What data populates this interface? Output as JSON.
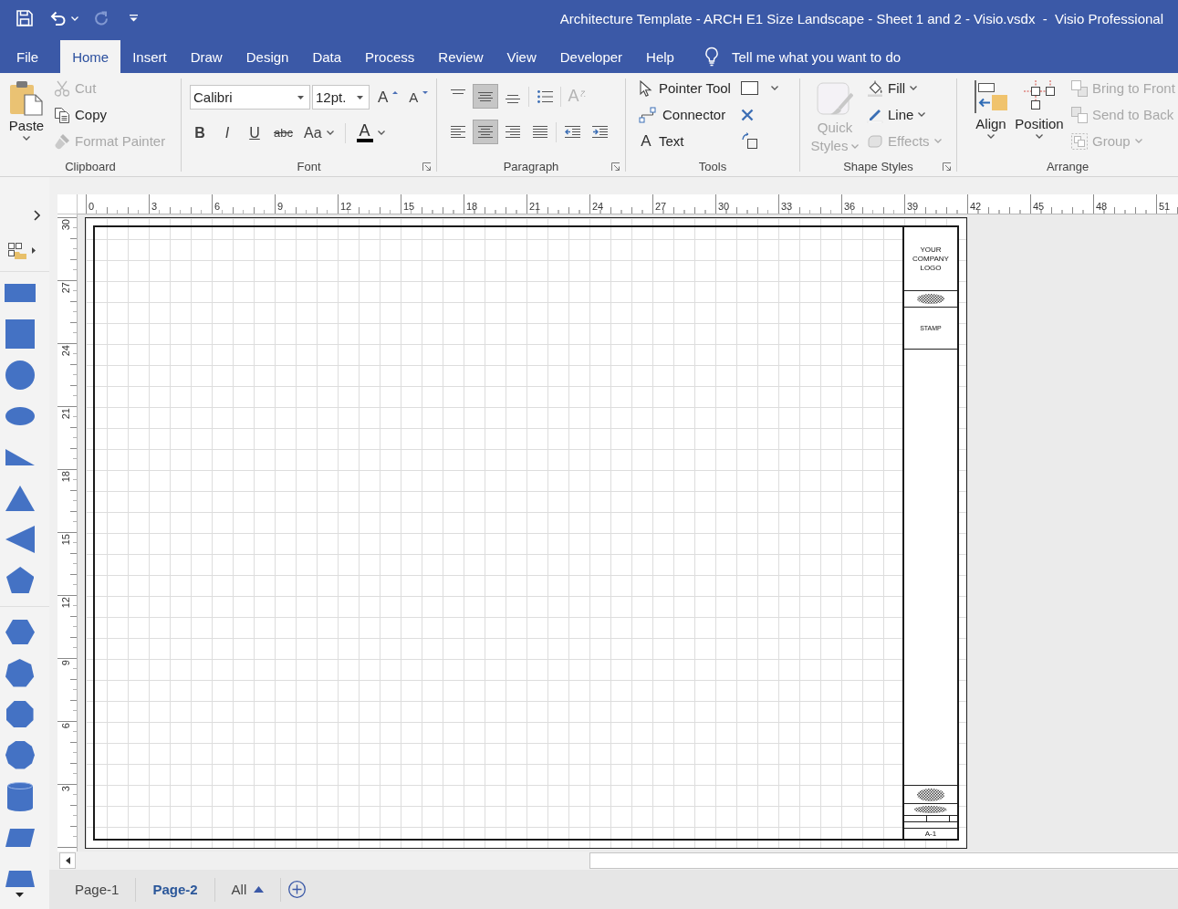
{
  "quick_access": [
    {
      "kind": "save",
      "disabled": false
    },
    {
      "kind": "undo",
      "disabled": false
    },
    {
      "kind": "redo",
      "disabled": true
    },
    {
      "kind": "customize",
      "disabled": false
    }
  ],
  "window": {
    "title": "Architecture Template - ARCH E1 Size Landscape - Sheet 1 and 2 - Visio.vsdx  -  Visio Professional"
  },
  "tabs": [
    {
      "label": "File",
      "selected": false
    },
    {
      "label": "Home",
      "selected": true
    },
    {
      "label": "Insert",
      "selected": false
    },
    {
      "label": "Draw",
      "selected": false
    },
    {
      "label": "Design",
      "selected": false
    },
    {
      "label": "Data",
      "selected": false
    },
    {
      "label": "Process",
      "selected": false
    },
    {
      "label": "Review",
      "selected": false
    },
    {
      "label": "View",
      "selected": false
    },
    {
      "label": "Developer",
      "selected": false
    },
    {
      "label": "Help",
      "selected": false
    }
  ],
  "tell_me": {
    "placeholder": "Tell me what you want to do"
  },
  "ribbon": {
    "clipboard": {
      "label": "Clipboard",
      "paste": {
        "label": "Paste"
      },
      "items": [
        {
          "kind": "cut",
          "label": "Cut",
          "disabled": true
        },
        {
          "kind": "copy",
          "label": "Copy",
          "disabled": false
        },
        {
          "kind": "format_painter",
          "label": "Format Painter",
          "disabled": true
        }
      ]
    },
    "font": {
      "label": "Font",
      "launcher": true,
      "font_name": "Calibri",
      "font_size": "12pt.",
      "size_buttons": [
        {
          "kind": "grow",
          "glyph": "A"
        },
        {
          "kind": "shrink",
          "glyph": "A"
        }
      ],
      "format_buttons": [
        {
          "kind": "bold",
          "glyph": "B"
        },
        {
          "kind": "italic",
          "glyph": "I"
        },
        {
          "kind": "underline",
          "glyph": "U"
        },
        {
          "kind": "strikethrough",
          "glyph": "abc"
        },
        {
          "kind": "case",
          "glyph": "Aa"
        }
      ],
      "color_button": {
        "glyph": "A"
      }
    },
    "paragraph": {
      "label": "Paragraph",
      "launcher": true,
      "rows": [
        [
          [
            {
              "kind": "align_top",
              "selected": false,
              "disabled": false
            },
            {
              "kind": "align_middle",
              "selected": true,
              "disabled": false
            },
            {
              "kind": "align_bottom",
              "selected": false,
              "disabled": false
            }
          ],
          [
            {
              "kind": "bullets",
              "selected": false,
              "disabled": false
            }
          ],
          [
            {
              "kind": "text_direction",
              "glyph": "A",
              "selected": false,
              "disabled": true
            }
          ]
        ],
        [
          [
            {
              "kind": "align_left",
              "selected": false,
              "disabled": false
            },
            {
              "kind": "align_center",
              "selected": true,
              "disabled": false
            },
            {
              "kind": "align_right",
              "selected": false,
              "disabled": false
            },
            {
              "kind": "justify",
              "selected": false,
              "disabled": false
            }
          ],
          [
            {
              "kind": "decrease_indent",
              "selected": false,
              "disabled": false
            },
            {
              "kind": "increase_indent",
              "selected": false,
              "disabled": false
            }
          ]
        ]
      ]
    },
    "tools": {
      "label": "Tools",
      "items": [
        {
          "kind": "pointer",
          "label": "Pointer Tool"
        },
        {
          "kind": "connector",
          "label": "Connector"
        },
        {
          "kind": "text",
          "glyph": "A",
          "label": "Text"
        }
      ],
      "side_buttons": [
        {
          "kind": "rectangle",
          "menu": true
        },
        {
          "kind": "connection_point",
          "menu": false
        },
        {
          "kind": "text_block",
          "menu": false
        }
      ]
    },
    "shape_styles": {
      "label": "Shape Styles",
      "launcher": true,
      "quick_styles": {
        "label": "Quick Styles",
        "disabled": true
      },
      "items": [
        {
          "kind": "fill",
          "label": "Fill",
          "disabled": false
        },
        {
          "kind": "line",
          "label": "Line",
          "disabled": false
        },
        {
          "kind": "effects",
          "label": "Effects",
          "disabled": true
        }
      ]
    },
    "arrange": {
      "label": "Arrange",
      "big": [
        {
          "kind": "align",
          "label": "Align"
        },
        {
          "kind": "position",
          "label": "Position"
        }
      ],
      "items": [
        {
          "kind": "bring_front",
          "label": "Bring to Front",
          "disabled": true,
          "menu": false
        },
        {
          "kind": "send_back",
          "label": "Send to Back",
          "disabled": true,
          "menu": false
        },
        {
          "kind": "group",
          "label": "Group",
          "disabled": true,
          "menu": true
        }
      ]
    }
  },
  "stencil": {
    "sections": [
      {
        "shapes": [
          {
            "kind": "rectangle"
          },
          {
            "kind": "square"
          },
          {
            "kind": "circle"
          },
          {
            "kind": "ellipse"
          },
          {
            "kind": "right_triangle"
          },
          {
            "kind": "triangle"
          },
          {
            "kind": "left_triangle"
          },
          {
            "kind": "pentagon"
          }
        ]
      },
      {
        "shapes": [
          {
            "kind": "hexagon"
          },
          {
            "kind": "heptagon"
          },
          {
            "kind": "octagon"
          },
          {
            "kind": "decagon"
          },
          {
            "kind": "cylinder"
          },
          {
            "kind": "parallelogram"
          },
          {
            "kind": "trapezoid"
          }
        ]
      }
    ]
  },
  "rulers": {
    "horizontal": [
      "0",
      "3",
      "6",
      "9",
      "12",
      "15",
      "18",
      "21",
      "24",
      "27",
      "30",
      "33",
      "36",
      "39",
      "42",
      "45",
      "48",
      "51"
    ],
    "vertical": [
      "30",
      "27",
      "24",
      "21",
      "18",
      "15",
      "12",
      "9",
      "6",
      "3"
    ]
  },
  "title_block": {
    "logo": "YOUR COMPANY LOGO",
    "stamp": "STAMP",
    "sheet": "A-1"
  },
  "page_tabs": [
    {
      "label": "Page-1",
      "selected": false
    },
    {
      "label": "Page-2",
      "selected": true
    }
  ],
  "all_pages": {
    "label": "All"
  }
}
